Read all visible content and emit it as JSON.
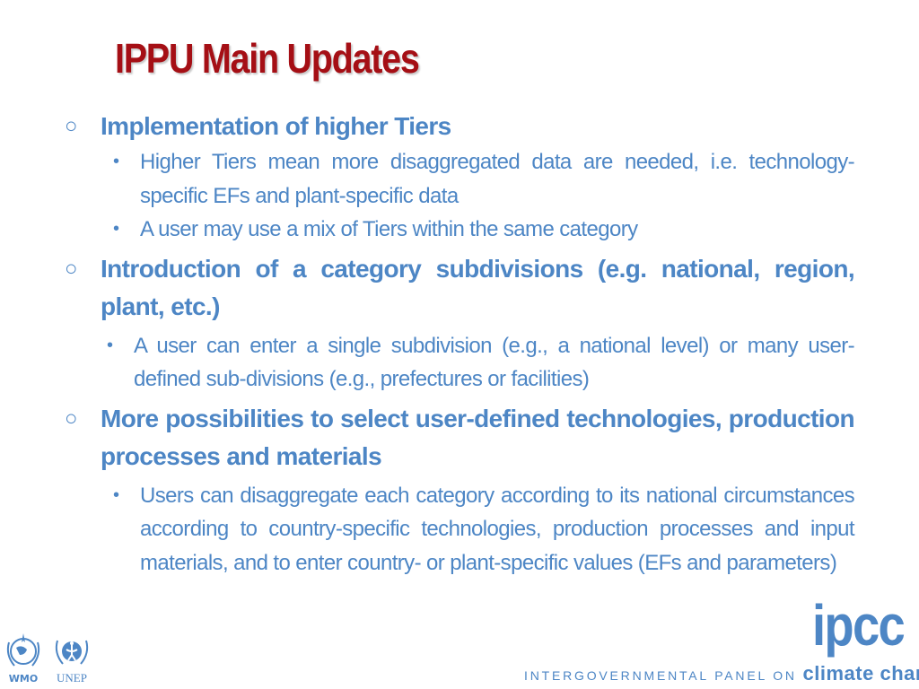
{
  "slide": {
    "title": "IPPU Main Updates",
    "colors": {
      "title": "#a50f15",
      "body": "#4d86c5"
    },
    "bullets": [
      {
        "text": "Implementation of higher Tiers",
        "sub": [
          "Higher Tiers mean more disaggregated data are needed, i.e. technology-specific EFs and plant-specific data",
          "A user may use a mix of Tiers within the same category"
        ]
      },
      {
        "text": "Introduction of a category subdivisions (e.g. national, region, plant, etc.)",
        "sub": [
          "A user can enter a single subdivision (e.g., a national level) or many user-defined sub-divisions (e.g., prefectures or facilities)"
        ]
      },
      {
        "text": "More possibilities to select user-defined technologies, production processes and materials",
        "sub": [
          "Users can disaggregate each category according to its national circumstances according to country-specific technologies, production processes and input materials, and to enter country- or plant-specific values (EFs and parameters)"
        ]
      }
    ],
    "bullet_glyph_l1": "○",
    "bullet_glyph_l2": "•"
  },
  "footer": {
    "wmo_label": "WMO",
    "unep_label": "UNEP",
    "ipcc_word": "ipcc",
    "ipcc_tag_prefix": "INTERGOVERNMENTAL PANEL ON ",
    "ipcc_tag_suffix": "climate change"
  }
}
